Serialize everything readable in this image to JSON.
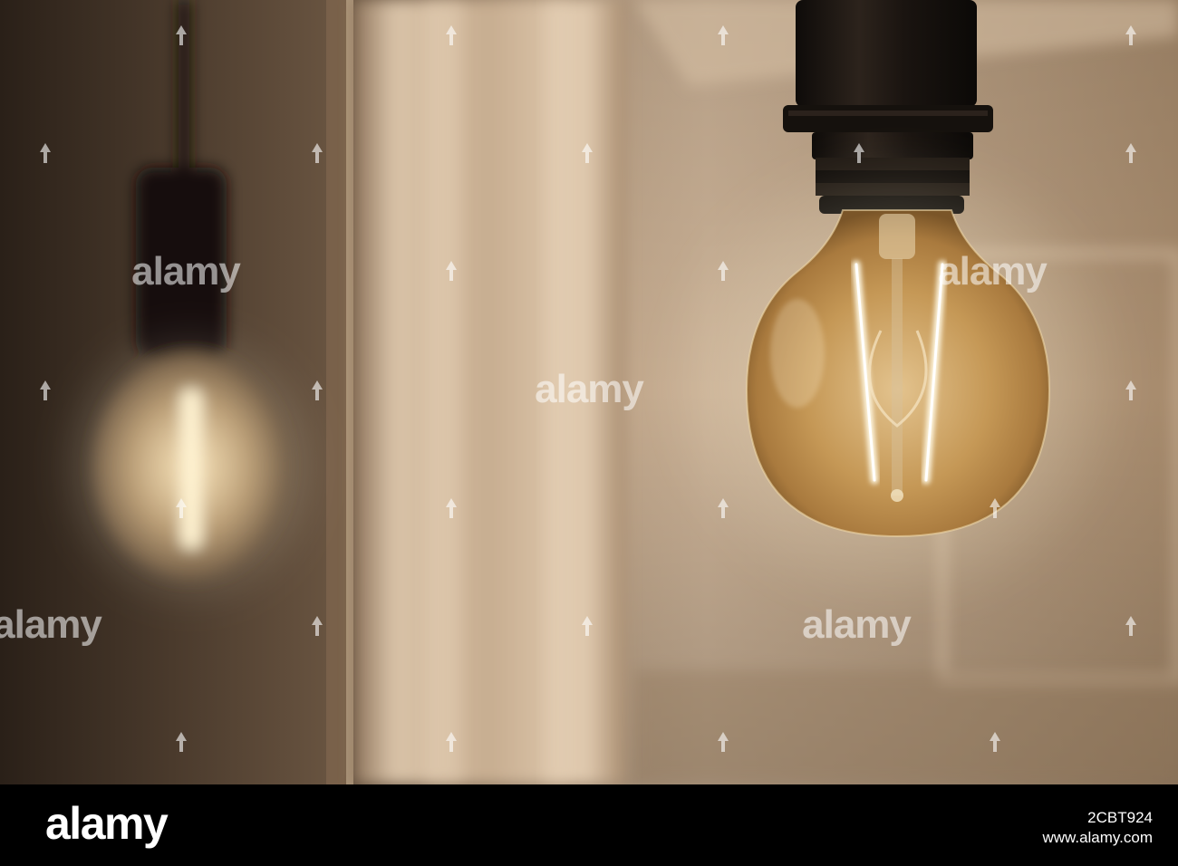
{
  "photo": {
    "subject": "filament-globe-bulb",
    "colors": {
      "wall_light": "#cfb89f",
      "wall_mid": "#a6896b",
      "wall_dark": "#5e4a39",
      "mirror_dark": "#3a2c20",
      "socket": "#1c1612",
      "bulb_glass": "#c79a55",
      "filament_glow": "#fff6dc"
    }
  },
  "watermark": {
    "text": "alamy"
  },
  "footer": {
    "brand": "alamy",
    "image_id": "2CBT924",
    "site": "www.alamy.com"
  }
}
